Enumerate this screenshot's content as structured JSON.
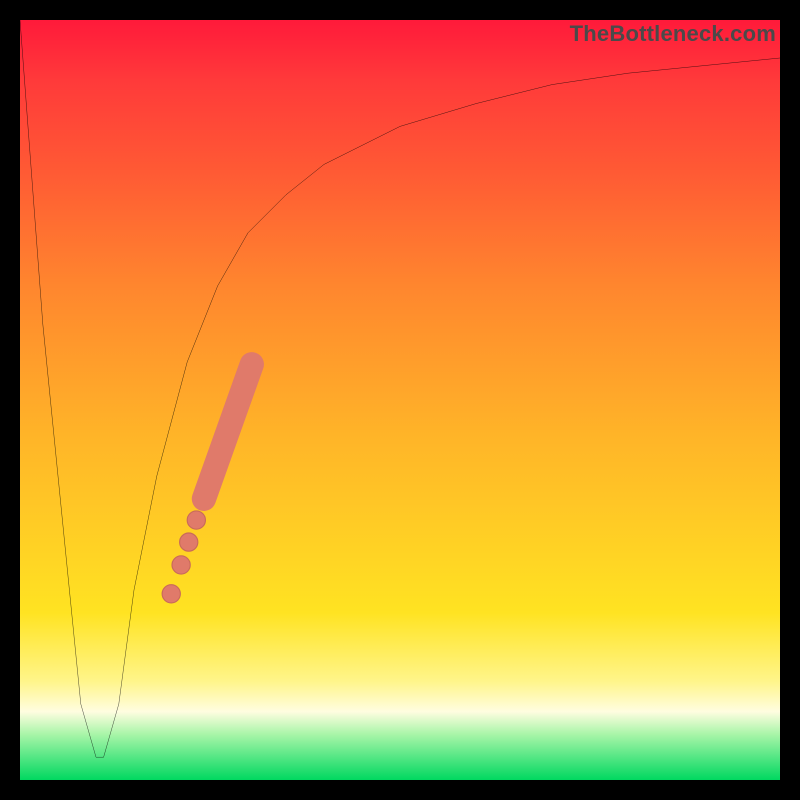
{
  "watermark": "TheBottleneck.com",
  "colors": {
    "frame": "#000000",
    "curve": "#000000",
    "marker_fill": "#e07a6a",
    "marker_stroke": "#c96a5a"
  },
  "chart_data": {
    "type": "line",
    "title": "",
    "xlabel": "",
    "ylabel": "",
    "xlim": [
      0,
      100
    ],
    "ylim": [
      0,
      100
    ],
    "grid": false,
    "series": [
      {
        "name": "bottleneck-curve",
        "x": [
          0,
          3,
          6,
          8,
          10,
          11,
          13,
          15,
          18,
          22,
          26,
          30,
          35,
          40,
          50,
          60,
          70,
          80,
          90,
          100
        ],
        "y": [
          100,
          60,
          30,
          10,
          3,
          3,
          10,
          25,
          40,
          55,
          65,
          72,
          77,
          81,
          86,
          89,
          91.5,
          93,
          94,
          95
        ]
      }
    ],
    "markers": [
      {
        "shape": "pill",
        "x0": 24.2,
        "y0": 37.0,
        "x1": 30.5,
        "y1": 54.7,
        "rx": 1.6
      },
      {
        "shape": "circle",
        "cx": 23.2,
        "cy": 34.2,
        "r": 1.2
      },
      {
        "shape": "circle",
        "cx": 22.2,
        "cy": 31.3,
        "r": 1.2
      },
      {
        "shape": "circle",
        "cx": 21.2,
        "cy": 28.3,
        "r": 1.2
      },
      {
        "shape": "circle",
        "cx": 19.9,
        "cy": 24.5,
        "r": 1.2
      }
    ],
    "annotations": []
  }
}
